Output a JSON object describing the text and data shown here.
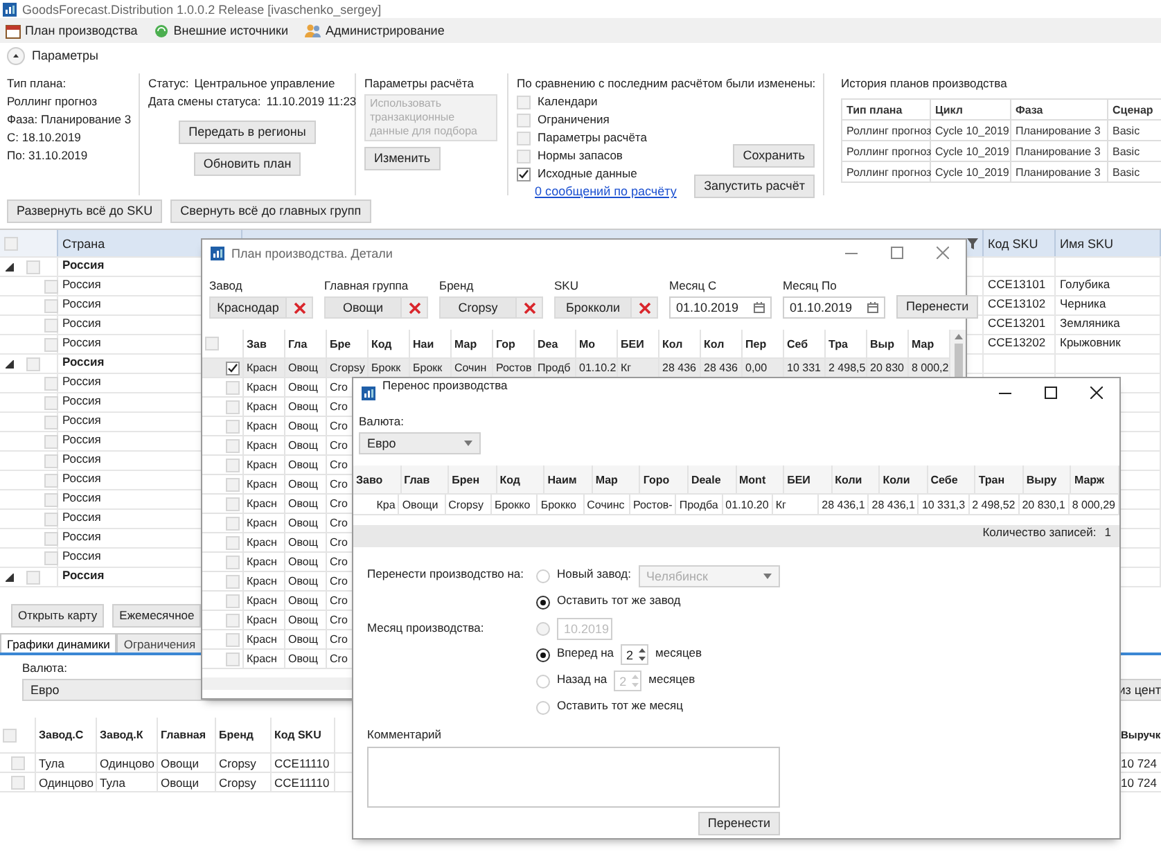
{
  "window": {
    "title": "GoodsForecast.Distribution 1.0.0.2 Release [ivaschenko_sergey]"
  },
  "menu": [
    {
      "label": "План производства"
    },
    {
      "label": "Внешние источники"
    },
    {
      "label": "Администрирование"
    }
  ],
  "params_toggle": {
    "label": "Параметры",
    "expanded": true
  },
  "plan_info": [
    "Тип плана:",
    "Роллинг прогноз",
    "Фаза: Планирование 3",
    "С: 18.10.2019",
    "По: 31.10.2019"
  ],
  "status": {
    "status_label": "Статус:",
    "status_value": "Центральное управление",
    "date_label": "Дата смены статуса:",
    "date_value": "11.10.2019 11:23",
    "buttons": [
      "Передать в регионы",
      "Обновить план"
    ]
  },
  "calc_params": {
    "title": "Параметры расчёта",
    "text": "Использовать транзакционные данные для подбора",
    "disabled": true,
    "button": "Изменить"
  },
  "changes": {
    "title": "По сравнению с последним расчётом были изменены:",
    "items": [
      {
        "label": "Календари",
        "checked": false
      },
      {
        "label": "Ограничения",
        "checked": false
      },
      {
        "label": "Параметры расчёта",
        "checked": false
      },
      {
        "label": "Нормы запасов",
        "checked": false
      },
      {
        "label": "Исходные данные",
        "checked": true
      }
    ],
    "link": "0 сообщений по расчёту",
    "buttons": [
      "Сохранить",
      "Запустить расчёт"
    ]
  },
  "history": {
    "title": "История планов производства",
    "columns": [
      "Тип плана",
      "Цикл",
      "Фаза",
      "Сценар"
    ],
    "rows": [
      [
        "Роллинг прогноз",
        "Cycle 10_2019",
        "Планирование 3",
        "Basic"
      ],
      [
        "Роллинг прогноз",
        "Cycle 10_2019",
        "Планирование 3",
        "Basic"
      ],
      [
        "Роллинг прогноз",
        "Cycle 10_2019",
        "Планирование 3",
        "Basic"
      ]
    ]
  },
  "toolbar": [
    "Развернуть всё до SKU",
    "Свернуть всё до главных групп"
  ],
  "grid": {
    "all_checked": false,
    "columns": [
      "Страна",
      "Код SKU",
      "Имя SKU"
    ],
    "rows": [
      {
        "kind": "group",
        "country": "Россия",
        "expanded": true,
        "checked": false
      },
      {
        "kind": "item",
        "country": "Россия",
        "sku_code": "CCE13101",
        "sku_name": "Голубика",
        "checked": false
      },
      {
        "kind": "item",
        "country": "Россия",
        "sku_code": "CCE13102",
        "sku_name": "Черника",
        "checked": false
      },
      {
        "kind": "item",
        "country": "Россия",
        "sku_code": "CCE13201",
        "sku_name": "Земляника",
        "checked": false
      },
      {
        "kind": "item",
        "country": "Россия",
        "sku_code": "CCE13202",
        "sku_name": "Крыжовник",
        "checked": false
      },
      {
        "kind": "group",
        "country": "Россия",
        "expanded": true,
        "checked": false
      },
      {
        "kind": "item",
        "country": "Россия",
        "checked": false
      },
      {
        "kind": "item",
        "country": "Россия",
        "checked": false
      },
      {
        "kind": "item",
        "country": "Россия",
        "checked": false
      },
      {
        "kind": "item",
        "country": "Россия",
        "checked": false
      },
      {
        "kind": "item",
        "country": "Россия",
        "checked": false
      },
      {
        "kind": "item",
        "country": "Россия",
        "checked": false
      },
      {
        "kind": "item",
        "country": "Россия",
        "checked": false
      },
      {
        "kind": "item",
        "country": "Россия",
        "checked": false
      },
      {
        "kind": "item",
        "country": "Россия",
        "checked": false
      },
      {
        "kind": "item",
        "country": "Россия",
        "checked": false
      },
      {
        "kind": "group",
        "country": "Россия",
        "expanded": true,
        "checked": false
      }
    ]
  },
  "bottom_buttons": [
    "Открыть карту",
    "Ежемесячное"
  ],
  "tabs": [
    {
      "label": "Графики динамики",
      "selected": true
    },
    {
      "label": "Ограничения",
      "selected": false
    }
  ],
  "currency": {
    "label": "Валюта:",
    "value": "Евро"
  },
  "right_button": "из цент",
  "bottom_grid": {
    "all_checked": false,
    "columns": [
      "Завод.С",
      "Завод.К",
      "Главная",
      "Бренд",
      "Код SKU"
    ],
    "last_column": "Выручк",
    "rows": [
      {
        "checked": false,
        "cells": [
          "Тула",
          "Одинцово",
          "Овощи",
          "Cropsy",
          "CCE11110"
        ],
        "last": "10 724"
      },
      {
        "checked": false,
        "cells": [
          "Одинцово",
          "Тула",
          "Овощи",
          "Cropsy",
          "CCE11110"
        ],
        "last": "10 724"
      }
    ]
  },
  "details_dialog": {
    "title": "План производства. Детали",
    "filters": [
      {
        "label": "Завод",
        "value": "Краснодар"
      },
      {
        "label": "Главная группа",
        "value": "Овощи"
      },
      {
        "label": "Бренд",
        "value": "Cropsy"
      },
      {
        "label": "SKU",
        "value": "Брокколи"
      }
    ],
    "dates": [
      {
        "label": "Месяц С",
        "value": "01.10.2019"
      },
      {
        "label": "Месяц По",
        "value": "01.10.2019"
      }
    ],
    "button": "Перенести",
    "all_checked": false,
    "columns": [
      "Зав",
      "Гла",
      "Бре",
      "Код",
      "Наи",
      "Мар",
      "Гор",
      "Dea",
      "Мо",
      "БЕИ",
      "Кол",
      "Кол",
      "Пер",
      "Себ",
      "Тра",
      "Выр",
      "Мар"
    ],
    "rows": [
      {
        "checked": true,
        "cells": [
          "Красн",
          "Овощ",
          "Cropsy",
          "Брокк",
          "Брокк",
          "Сочин",
          "Ростов",
          "Продб",
          "01.10.2",
          "Кг",
          "28 436",
          "28 436",
          "0,00",
          "10 331",
          "2 498,5",
          "20 830",
          "8 000,2"
        ]
      },
      {
        "checked": false,
        "cells": [
          "Красн",
          "Овощ",
          "Cro"
        ]
      },
      {
        "checked": false,
        "cells": [
          "Красн",
          "Овощ",
          "Cro"
        ]
      },
      {
        "checked": false,
        "cells": [
          "Красн",
          "Овощ",
          "Cro"
        ]
      },
      {
        "checked": false,
        "cells": [
          "Красн",
          "Овощ",
          "Cro"
        ]
      },
      {
        "checked": false,
        "cells": [
          "Красн",
          "Овощ",
          "Cro"
        ]
      },
      {
        "checked": false,
        "cells": [
          "Красн",
          "Овощ",
          "Cro"
        ]
      },
      {
        "checked": false,
        "cells": [
          "Красн",
          "Овощ",
          "Cro"
        ]
      },
      {
        "checked": false,
        "cells": [
          "Красн",
          "Овощ",
          "Cro"
        ]
      },
      {
        "checked": false,
        "cells": [
          "Красн",
          "Овощ",
          "Cro"
        ]
      },
      {
        "checked": false,
        "cells": [
          "Красн",
          "Овощ",
          "Cro"
        ]
      },
      {
        "checked": false,
        "cells": [
          "Красн",
          "Овощ",
          "Cro"
        ]
      },
      {
        "checked": false,
        "cells": [
          "Красн",
          "Овощ",
          "Cro"
        ]
      },
      {
        "checked": false,
        "cells": [
          "Красн",
          "Овощ",
          "Cro"
        ]
      },
      {
        "checked": false,
        "cells": [
          "Красн",
          "Овощ",
          "Cro"
        ]
      },
      {
        "checked": false,
        "cells": [
          "Красн",
          "Овощ",
          "Cro"
        ]
      }
    ]
  },
  "transfer_dialog": {
    "title": "Перенос производства",
    "currency": {
      "label": "Валюта:",
      "value": "Евро"
    },
    "columns": [
      "Заво",
      "Глав",
      "Брен",
      "Код",
      "Наим",
      "Мар",
      "Горо",
      "Deale",
      "Mont",
      "БЕИ",
      "Коли",
      "Коли",
      "Себе",
      "Тран",
      "Выру",
      "Марж"
    ],
    "row": [
      "Кра",
      "Овощи",
      "Cropsy",
      "Брокко",
      "Брокко",
      "Сочинс",
      "Ростов-",
      "Продба",
      "01.10.20",
      "Кг",
      "28 436,1",
      "28 436,1",
      "10 331,3",
      "2 498,52",
      "20 830,1",
      "8 000,29"
    ],
    "count_label": "Количество записей:",
    "count": "1",
    "target": {
      "label": "Перенести производство на:",
      "options": [
        {
          "kind": "new_plant",
          "label": "Новый завод:",
          "value": "Челябинск",
          "selected": false
        },
        {
          "kind": "same",
          "label": "Оставить тот же завод",
          "selected": true
        }
      ]
    },
    "month": {
      "label": "Месяц производства:",
      "options": [
        {
          "kind": "date",
          "value": "10.2019",
          "selected": false
        },
        {
          "kind": "shift",
          "label": "Вперед на",
          "value": "2",
          "unit": "месяцев",
          "selected": true
        },
        {
          "kind": "shift",
          "label": "Назад на",
          "value": "2",
          "unit": "месяцев",
          "selected": false
        },
        {
          "kind": "same",
          "label": "Оставить тот же месяц",
          "selected": false
        }
      ]
    },
    "comment": {
      "label": "Комментарий"
    },
    "button": "Перенести"
  }
}
